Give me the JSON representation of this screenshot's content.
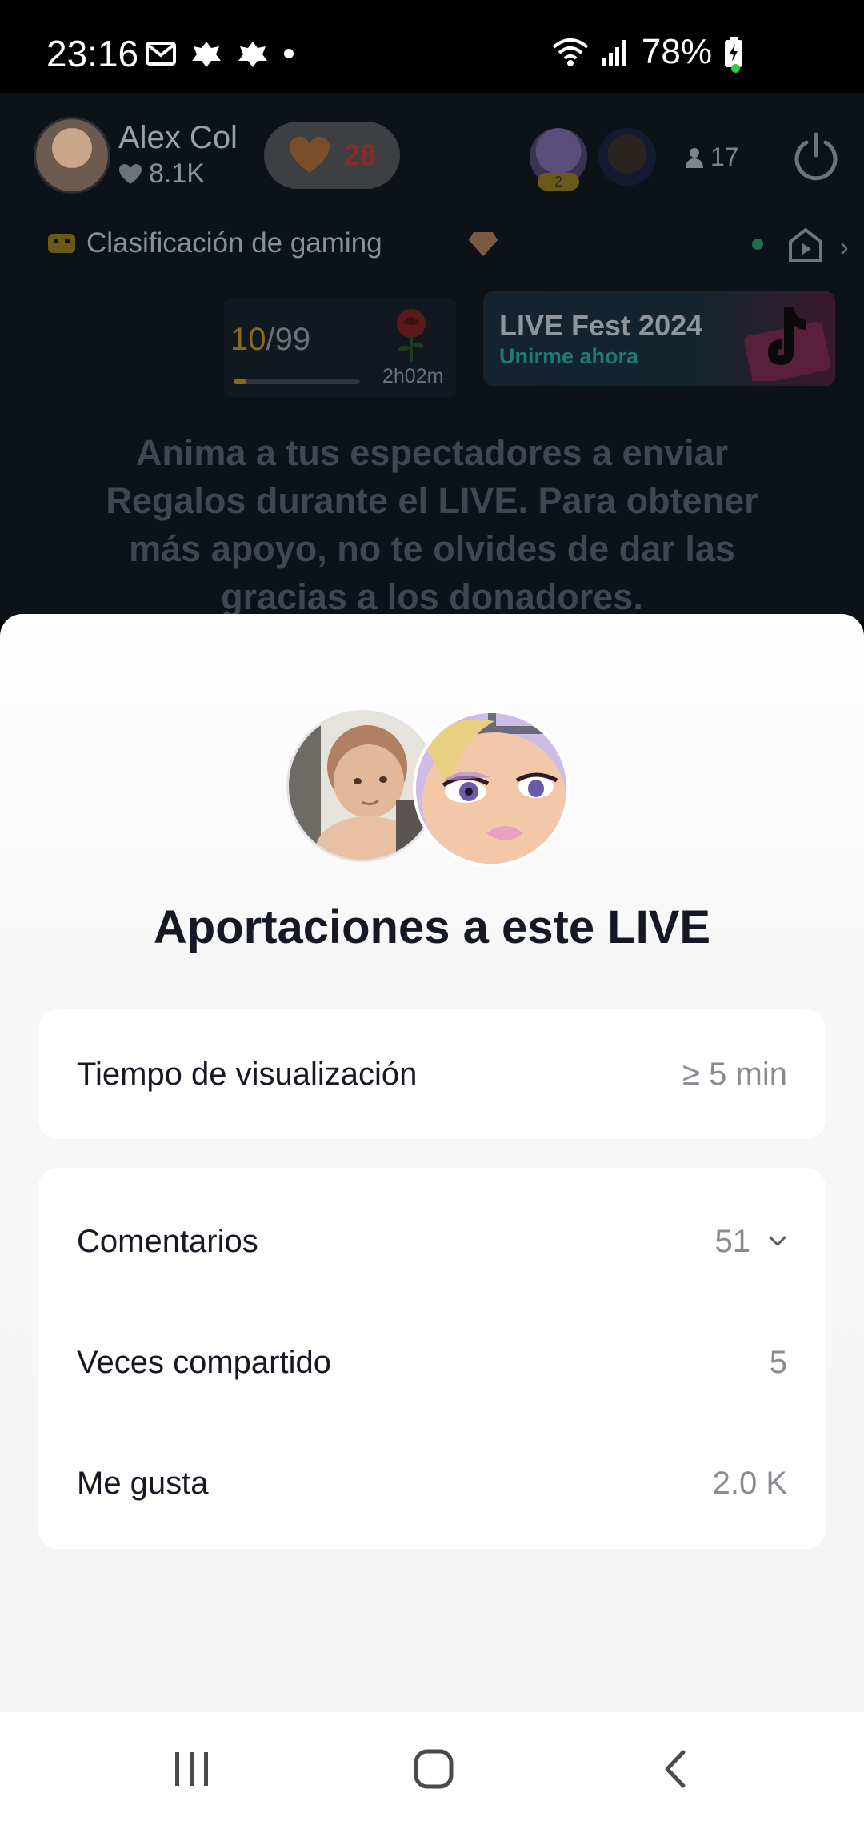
{
  "status_bar": {
    "time": "23:16",
    "battery": "78%"
  },
  "live": {
    "host_name": "Alex Col",
    "host_likes": "8.1K",
    "heart_count": "28",
    "viewer_badge": "2",
    "viewer_count": "17",
    "category": "Clasificación de gaming",
    "rank_current": "10",
    "rank_total": "/99",
    "rank_progress": 0.1,
    "gift_timer": "2h02m",
    "fest_title": "LIVE Fest 2024",
    "fest_subtitle": "Unirme ahora",
    "encouragement": "Anima a tus espectadores a enviar Regalos durante el LIVE. Para obtener más apoyo, no te olvides de dar las gracias a los donadores."
  },
  "sheet": {
    "title": "Aportaciones a este LIVE",
    "watch_time": {
      "label": "Tiempo de visualización",
      "value": "≥ 5 min"
    },
    "stats": [
      {
        "label": "Comentarios",
        "value": "51",
        "expandable": true
      },
      {
        "label": "Veces compartido",
        "value": "5"
      },
      {
        "label": "Me gusta",
        "value": "2.0 K"
      }
    ]
  },
  "colors": {
    "sheet_bg": "#f4f4f5",
    "card_bg": "#ffffff",
    "text_primary": "#161823",
    "text_secondary": "#8a8b91",
    "live_bg": "#0d1219"
  },
  "nav": {
    "recents": "recents-icon",
    "home": "home-icon",
    "back": "back-icon"
  }
}
